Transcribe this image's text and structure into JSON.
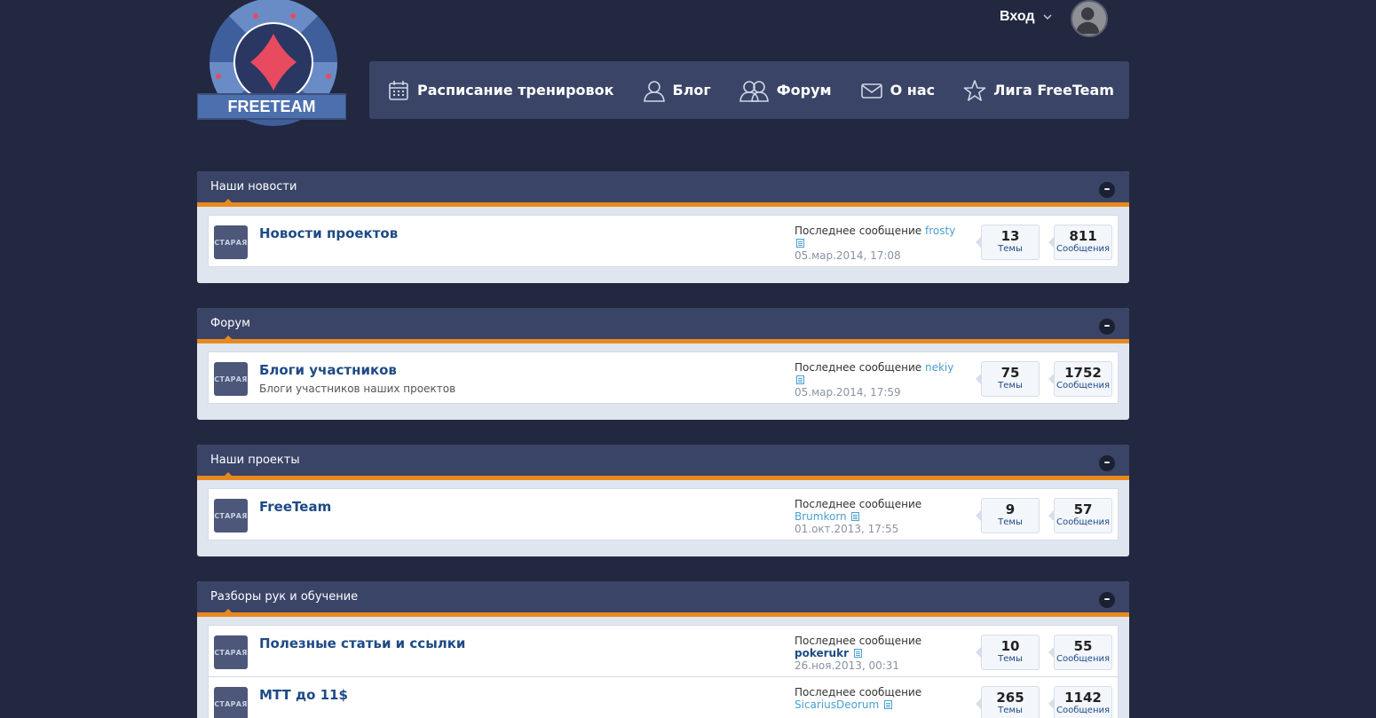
{
  "logo": {
    "text": "FREETEAM"
  },
  "user": {
    "login_label": "Вход"
  },
  "nav": [
    {
      "label": "Расписание тренировок",
      "icon": "calendar-icon"
    },
    {
      "label": "Блог",
      "icon": "user-icon"
    },
    {
      "label": "Форум",
      "icon": "users-icon"
    },
    {
      "label": "О нас",
      "icon": "envelope-icon"
    },
    {
      "label": "Лига FreeTeam",
      "icon": "star-icon"
    }
  ],
  "labels": {
    "last_post": "Последнее сообщение",
    "topics": "Темы",
    "posts": "Сообщения",
    "badge": "СТАРАЯ"
  },
  "colors": {
    "background": "#212840",
    "header": "#3a4467",
    "accent": "#e8891e",
    "link": "#1e4a86"
  },
  "categories": [
    {
      "title": "Наши новости",
      "forums": [
        {
          "title": "Новости проектов",
          "desc": "",
          "last_user": "frosty",
          "last_date": "05.мар.2014, 17:08",
          "topics": "13",
          "posts": "811"
        }
      ]
    },
    {
      "title": "Форум",
      "forums": [
        {
          "title": "Блоги участников",
          "desc": "Блоги участников наших проектов",
          "last_user": "nekiy",
          "last_date": "05.мар.2014, 17:59",
          "topics": "75",
          "posts": "1752"
        }
      ]
    },
    {
      "title": "Наши проекты",
      "forums": [
        {
          "title": "FreeTeam",
          "desc": "",
          "last_user": "Brumkorn",
          "last_date": "01.окт.2013, 17:55",
          "topics": "9",
          "posts": "57"
        }
      ]
    },
    {
      "title": "Разборы рук и обучение",
      "forums": [
        {
          "title": "Полезные статьи и ссылки",
          "desc": "",
          "last_user": "pokerukr",
          "last_date": "26.ноя.2013, 00:31",
          "topics": "10",
          "posts": "55"
        },
        {
          "title": "MTT до 11$",
          "desc": "",
          "last_user": "SicariusDeorum",
          "last_date": "",
          "topics": "265",
          "posts": "1142"
        }
      ]
    }
  ]
}
